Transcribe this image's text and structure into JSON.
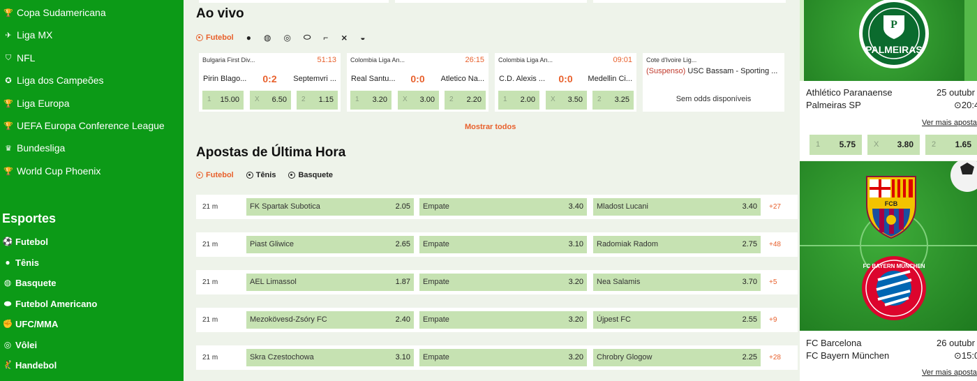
{
  "sidebar": {
    "leagues": [
      {
        "label": "Copa Sudamericana",
        "icon": "trophy-icon"
      },
      {
        "label": "Liga MX",
        "icon": "bird-icon"
      },
      {
        "label": "NFL",
        "icon": "shield-icon"
      },
      {
        "label": "Liga dos Campeões",
        "icon": "star-ball-icon"
      },
      {
        "label": "Liga Europa",
        "icon": "trophy-icon"
      },
      {
        "label": "UEFA Europa Conference League",
        "icon": "trophy-icon"
      },
      {
        "label": "Bundesliga",
        "icon": "eagle-icon"
      },
      {
        "label": "World Cup Phoenix",
        "icon": "trophy-icon"
      }
    ],
    "sports_title": "Esportes",
    "sports": [
      {
        "label": "Futebol",
        "icon": "soccer-ball-icon"
      },
      {
        "label": "Tênis",
        "icon": "tennis-ball-icon"
      },
      {
        "label": "Basquete",
        "icon": "basketball-icon"
      },
      {
        "label": "Futebol Americano",
        "icon": "american-football-icon"
      },
      {
        "label": "UFC/MMA",
        "icon": "glove-icon"
      },
      {
        "label": "Vôlei",
        "icon": "volleyball-icon"
      },
      {
        "label": "Handebol",
        "icon": "handball-icon"
      }
    ]
  },
  "live": {
    "title": "Ao vivo",
    "active_tab": "Futebol",
    "sport_icons": [
      "tennis-ball-icon",
      "basketball-icon",
      "volleyball-icon",
      "rugby-icon",
      "gun-icon",
      "hockey-icon",
      "helmet-icon"
    ],
    "matches": [
      {
        "league": "Bulgaria First Div...",
        "time": "51:13",
        "home": "Pirin Blago...",
        "score": "0:2",
        "away": "Septemvri ...",
        "odds": [
          {
            "label": "1",
            "value": "15.00"
          },
          {
            "label": "X",
            "value": "6.50"
          },
          {
            "label": "2",
            "value": "1.15"
          }
        ]
      },
      {
        "league": "Colombia Liga An...",
        "time": "26:15",
        "home": "Real Santu...",
        "score": "0:0",
        "away": "Atletico Na...",
        "odds": [
          {
            "label": "1",
            "value": "3.20"
          },
          {
            "label": "X",
            "value": "3.00"
          },
          {
            "label": "2",
            "value": "2.20"
          }
        ]
      },
      {
        "league": "Colombia Liga An...",
        "time": "09:01",
        "home": "C.D. Alexis ...",
        "score": "0:0",
        "away": "Medellin Ci...",
        "odds": [
          {
            "label": "1",
            "value": "2.00"
          },
          {
            "label": "X",
            "value": "3.50"
          },
          {
            "label": "2",
            "value": "3.25"
          }
        ]
      }
    ],
    "suspended": {
      "league": "Cote d'Ivoire Lig...",
      "status": "(Suspenso)",
      "match": "USC Bassam - Sporting ...",
      "message": "Sem odds disponíveis"
    },
    "show_all": "Mostrar todos"
  },
  "last_minute": {
    "title": "Apostas de Última Hora",
    "tabs": [
      "Futebol",
      "Tênis",
      "Basquete"
    ],
    "rows": [
      {
        "time": "21 m",
        "home": "FK Spartak Subotica",
        "home_odd": "2.05",
        "draw": "Empate",
        "draw_odd": "3.40",
        "away": "Mladost Lucani",
        "away_odd": "3.40",
        "more": "+27"
      },
      {
        "time": "21 m",
        "home": "Piast Gliwice",
        "home_odd": "2.65",
        "draw": "Empate",
        "draw_odd": "3.10",
        "away": "Radomiak Radom",
        "away_odd": "2.75",
        "more": "+48"
      },
      {
        "time": "21 m",
        "home": "AEL Limassol",
        "home_odd": "1.87",
        "draw": "Empate",
        "draw_odd": "3.20",
        "away": "Nea Salamis",
        "away_odd": "3.70",
        "more": "+5"
      },
      {
        "time": "21 m",
        "home": "Mezokövesd-Zsóry FC",
        "home_odd": "2.40",
        "draw": "Empate",
        "draw_odd": "3.20",
        "away": "Újpest FC",
        "away_odd": "2.55",
        "more": "+9"
      },
      {
        "time": "21 m",
        "home": "Skra Czestochowa",
        "home_odd": "3.10",
        "draw": "Empate",
        "draw_odd": "3.20",
        "away": "Chrobry Glogow",
        "away_odd": "2.25",
        "more": "+28"
      }
    ]
  },
  "promos": [
    {
      "home": "Athlético Paranaense",
      "away": "Palmeiras SP",
      "date": "25 outubr",
      "time": "20:4",
      "more": "Ver mais aposta",
      "logo_text": "PALMEIRAS",
      "odds": [
        {
          "label": "1",
          "value": "5.75"
        },
        {
          "label": "X",
          "value": "3.80"
        },
        {
          "label": "2",
          "value": "1.65"
        }
      ]
    },
    {
      "home": "FC Barcelona",
      "away": "FC Bayern München",
      "date": "26 outubr",
      "time": "15:0",
      "more": "Ver mais aposta",
      "logo_text_1": "FCB",
      "logo_text_2": "FC BAYERN MÜNCHEN"
    }
  ],
  "colors": {
    "sidebar": "#0c9a17",
    "accent": "#e8602c",
    "odd_bg": "#c6e2b2",
    "page_bg": "#eef3ea"
  }
}
